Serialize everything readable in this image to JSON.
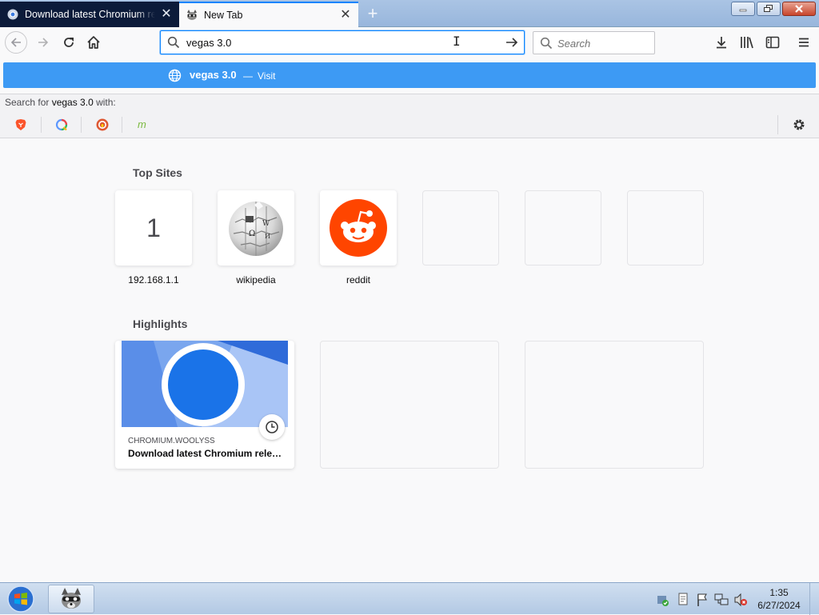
{
  "tabs": [
    {
      "title": "Download latest Chromium rel",
      "close": "✕"
    },
    {
      "title": "New Tab",
      "close": "✕"
    }
  ],
  "new_tab_symbol": "+",
  "urlbar": {
    "value": "vegas 3.0"
  },
  "searchbar": {
    "placeholder": "Search"
  },
  "suggestion": {
    "text": "vegas 3.0",
    "dash": "—",
    "action": "Visit"
  },
  "search_for": {
    "prefix": "Search for",
    "query": "vegas 3.0",
    "suffix": "with:"
  },
  "engines": [
    "brave",
    "qwant",
    "duckduckgo",
    "mojeek"
  ],
  "topsites": {
    "title": "Top Sites",
    "sites": [
      {
        "label": "192.168.1.1",
        "letter": "1"
      },
      {
        "label": "wikipedia"
      },
      {
        "label": "reddit"
      }
    ]
  },
  "highlights": {
    "title": "Highlights",
    "cards": [
      {
        "domain": "CHROMIUM.WOOLYSS",
        "title": "Download latest Chromium releases"
      }
    ]
  },
  "taskbar": {
    "time": "1:35",
    "date": "6/27/2024"
  },
  "colors": {
    "accent": "#0a84ff",
    "suggest_bg": "#3d9af4",
    "reddit": "#ff4500"
  }
}
